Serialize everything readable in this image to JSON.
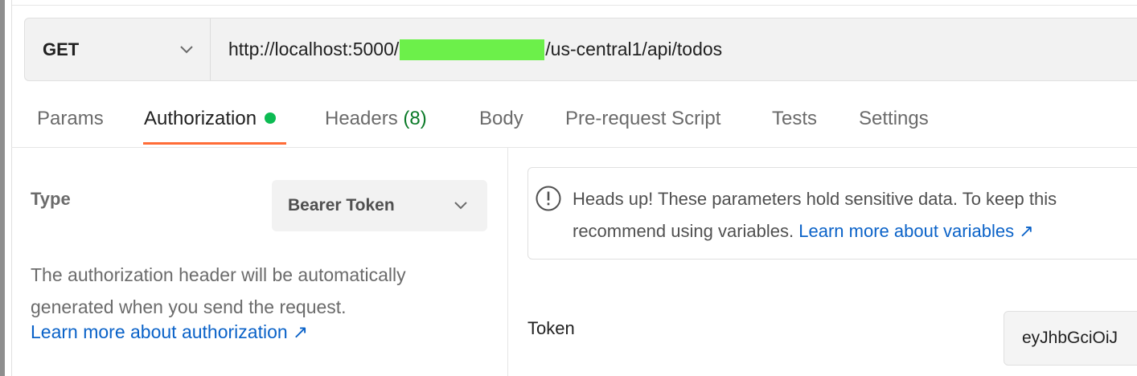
{
  "request": {
    "method": "GET",
    "url_prefix": "http://localhost:5000/",
    "url_suffix": "/us-central1/api/todos"
  },
  "tabs": [
    {
      "label": "Params"
    },
    {
      "label": "Authorization"
    },
    {
      "label": "Headers",
      "count": "(8)"
    },
    {
      "label": "Body"
    },
    {
      "label": "Pre-request Script"
    },
    {
      "label": "Tests"
    },
    {
      "label": "Settings"
    }
  ],
  "auth": {
    "type_label": "Type",
    "type_value": "Bearer Token",
    "description": "The authorization header will be automatically generated when you send the request.",
    "learn_link": "Learn more about authorization ↗"
  },
  "notice": {
    "line1": "Heads up! These parameters hold sensitive data. To keep this",
    "line2": "recommend using variables.",
    "link": "Learn more about variables ↗"
  },
  "token": {
    "label": "Token",
    "value": "eyJhbGciOiJ"
  },
  "colors": {
    "accent": "#ff6c37",
    "link": "#0a62c8",
    "status_dot": "#0cbb52"
  }
}
